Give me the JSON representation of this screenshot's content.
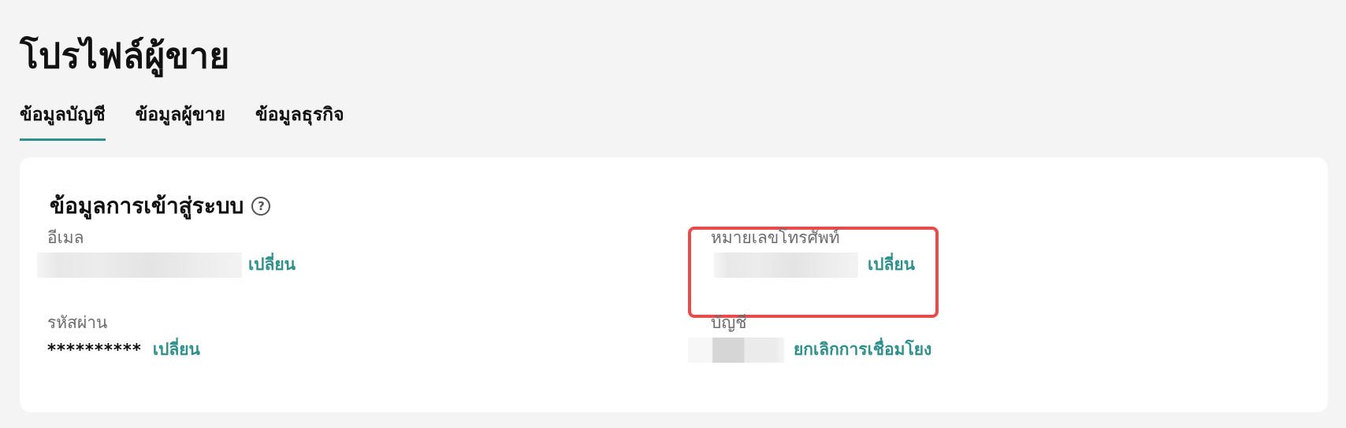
{
  "page": {
    "title": "โปรไฟล์ผู้ขาย"
  },
  "tabs": [
    {
      "label": "ข้อมูลบัญชี",
      "active": true
    },
    {
      "label": "ข้อมูลผู้ขาย",
      "active": false
    },
    {
      "label": "ข้อมูลธุรกิจ",
      "active": false
    }
  ],
  "login_section": {
    "title": "ข้อมูลการเข้าสู่ระบบ",
    "help_icon": "?",
    "email": {
      "label": "อีเมล",
      "action": "เปลี่ยน"
    },
    "phone": {
      "label": "หมายเลขโทรศัพท์",
      "action": "เปลี่ยน"
    },
    "password": {
      "label": "รหัสผ่าน",
      "value": "**********",
      "action": "เปลี่ยน"
    },
    "account": {
      "label": "บัญชี",
      "action": "ยกเลิกการเชื่อมโยง"
    }
  },
  "colors": {
    "accent": "#2f8f8b",
    "highlight": "#e84b4b",
    "background": "#f4f4f4",
    "card": "#ffffff"
  }
}
